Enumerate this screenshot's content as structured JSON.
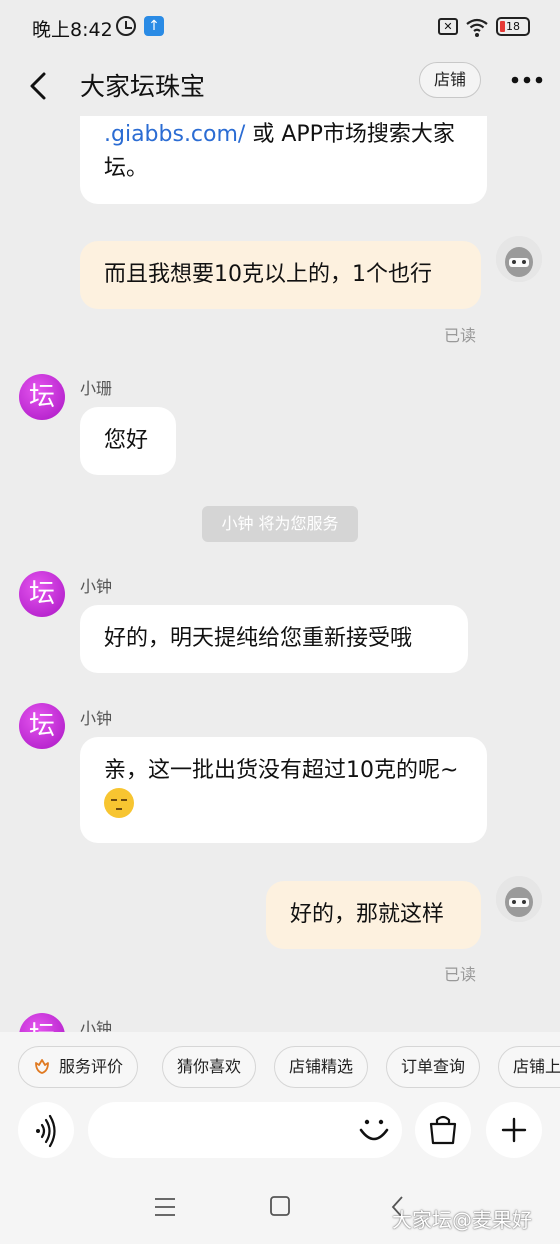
{
  "status": {
    "time": "晚上8:42",
    "battery": "18",
    "sim": "✕"
  },
  "header": {
    "title": "大家坛珠宝",
    "shop_label": "店铺"
  },
  "messages": {
    "m1_link": ".giabbs.com/",
    "m1_rest": " 或 APP市场搜索大家坛。",
    "m2": "而且我想要10克以上的，1个也行",
    "m2_read": "已读",
    "m3_sender": "小珊",
    "m3": "您好",
    "notice": "小钟 将为您服务",
    "m4_sender": "小钟",
    "m4": "好的，明天提纯给您重新接受哦",
    "m5_sender": "小钟",
    "m5": "亲，这一批出货没有超过10克的呢~",
    "m6": "好的，那就这样",
    "m6_read": "已读",
    "m7_sender": "小钟",
    "avatar_char": "坛"
  },
  "quick": [
    "服务评价",
    "猜你喜欢",
    "店铺精选",
    "订单查询",
    "店铺上新"
  ],
  "watermark": "大家坛@麦果好",
  "colors": {
    "background": "#ededed",
    "outgoing_bubble": "#fdf1df",
    "incoming_bubble": "#ffffff",
    "avatar_accent": "#c02ad6",
    "link": "#2b6cd3"
  },
  "icons": [
    "back-icon",
    "more-icon",
    "service-rating-icon",
    "voice-icon",
    "emoji-icon",
    "shopping-bag-icon",
    "plus-icon",
    "menu-icon",
    "home-icon",
    "back-nav-icon"
  ]
}
